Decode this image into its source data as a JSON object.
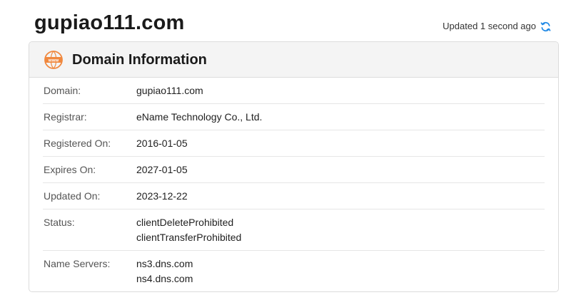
{
  "header": {
    "domain": "gupiao111.com",
    "updated_text": "Updated 1 second ago",
    "refresh_icon": "refresh-icon",
    "accent_color": "#1e88e5"
  },
  "card": {
    "title": "Domain Information",
    "icon": "www-icon",
    "icon_color": "#f0883e",
    "rows": [
      {
        "label": "Domain:",
        "values": [
          "gupiao111.com"
        ]
      },
      {
        "label": "Registrar:",
        "values": [
          "eName Technology Co., Ltd."
        ]
      },
      {
        "label": "Registered On:",
        "values": [
          "2016-01-05"
        ]
      },
      {
        "label": "Expires On:",
        "values": [
          "2027-01-05"
        ]
      },
      {
        "label": "Updated On:",
        "values": [
          "2023-12-22"
        ]
      },
      {
        "label": "Status:",
        "values": [
          "clientDeleteProhibited",
          "clientTransferProhibited"
        ]
      },
      {
        "label": "Name Servers:",
        "values": [
          "ns3.dns.com",
          "ns4.dns.com"
        ]
      }
    ]
  }
}
